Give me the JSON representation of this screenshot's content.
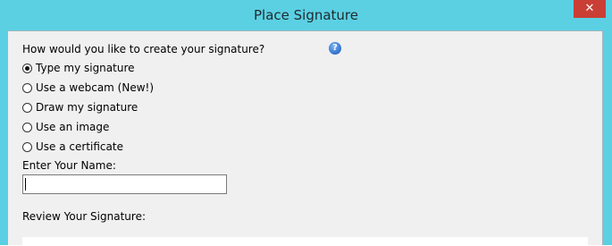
{
  "window": {
    "title": "Place Signature",
    "close_glyph": "✕"
  },
  "form": {
    "question": "How would you like to create your signature?",
    "help_glyph": "?",
    "options": [
      {
        "label": "Type my signature",
        "checked": true
      },
      {
        "label": "Use a webcam (New!)",
        "checked": false
      },
      {
        "label": "Draw my signature",
        "checked": false
      },
      {
        "label": "Use an image",
        "checked": false
      },
      {
        "label": "Use a certificate",
        "checked": false
      }
    ],
    "name_label": "Enter Your Name:",
    "name_value": "",
    "review_label": "Review Your Signature:"
  },
  "colors": {
    "titlebar": "#5bd0e3",
    "close_button": "#c93f35",
    "client_background": "#f0f0f0"
  }
}
